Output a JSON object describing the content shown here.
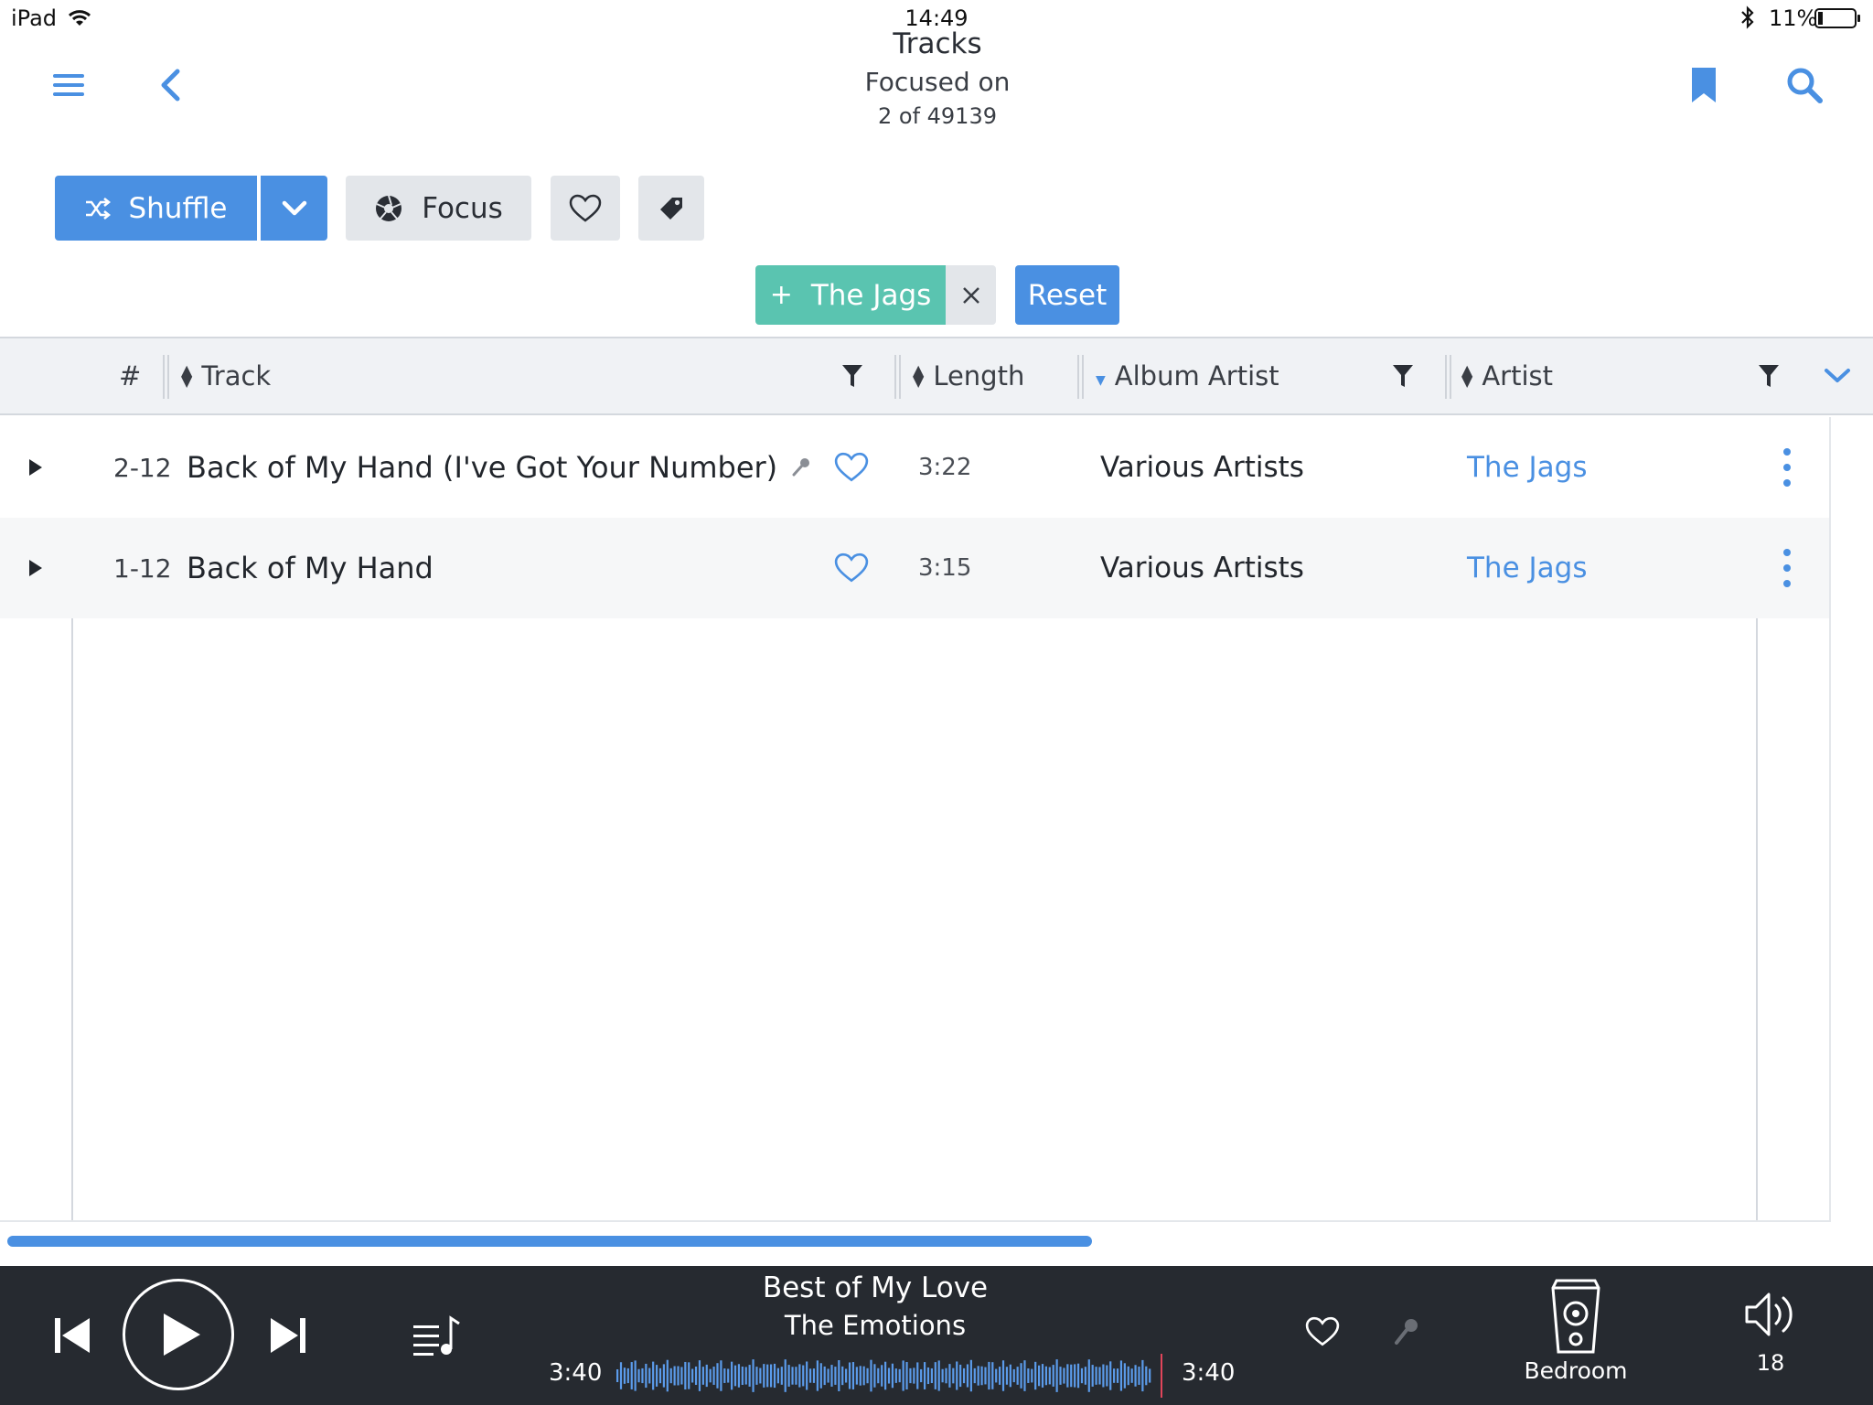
{
  "status_bar": {
    "device": "iPad",
    "time": "14:49",
    "battery": "11%"
  },
  "header": {
    "title": "Tracks",
    "subtitle": "Focused on",
    "count": "2 of 49139"
  },
  "toolbar": {
    "shuffle_label": "Shuffle",
    "focus_label": "Focus"
  },
  "filter": {
    "chip_label": "The Jags",
    "reset_label": "Reset"
  },
  "table": {
    "columns": {
      "num": "#",
      "track": "Track",
      "length": "Length",
      "album_artist": "Album Artist",
      "artist": "Artist"
    },
    "rows": [
      {
        "num": "2-12",
        "track": "Back of My Hand (I've Got Your Number)",
        "length": "3:22",
        "album_artist": "Various Artists",
        "artist": "The Jags",
        "has_lyrics": true
      },
      {
        "num": "1-12",
        "track": "Back of My Hand",
        "length": "3:15",
        "album_artist": "Various Artists",
        "artist": "The Jags",
        "has_lyrics": false
      }
    ],
    "scroll_progress": 0.76
  },
  "player": {
    "title": "Best of My Love",
    "artist": "The Emotions",
    "elapsed": "3:40",
    "total": "3:40",
    "progress": 1.0,
    "zone": "Bedroom",
    "volume": "18"
  },
  "colors": {
    "accent": "#4a90e2",
    "chip": "#5ac4b0",
    "player_bg": "#262a30"
  }
}
